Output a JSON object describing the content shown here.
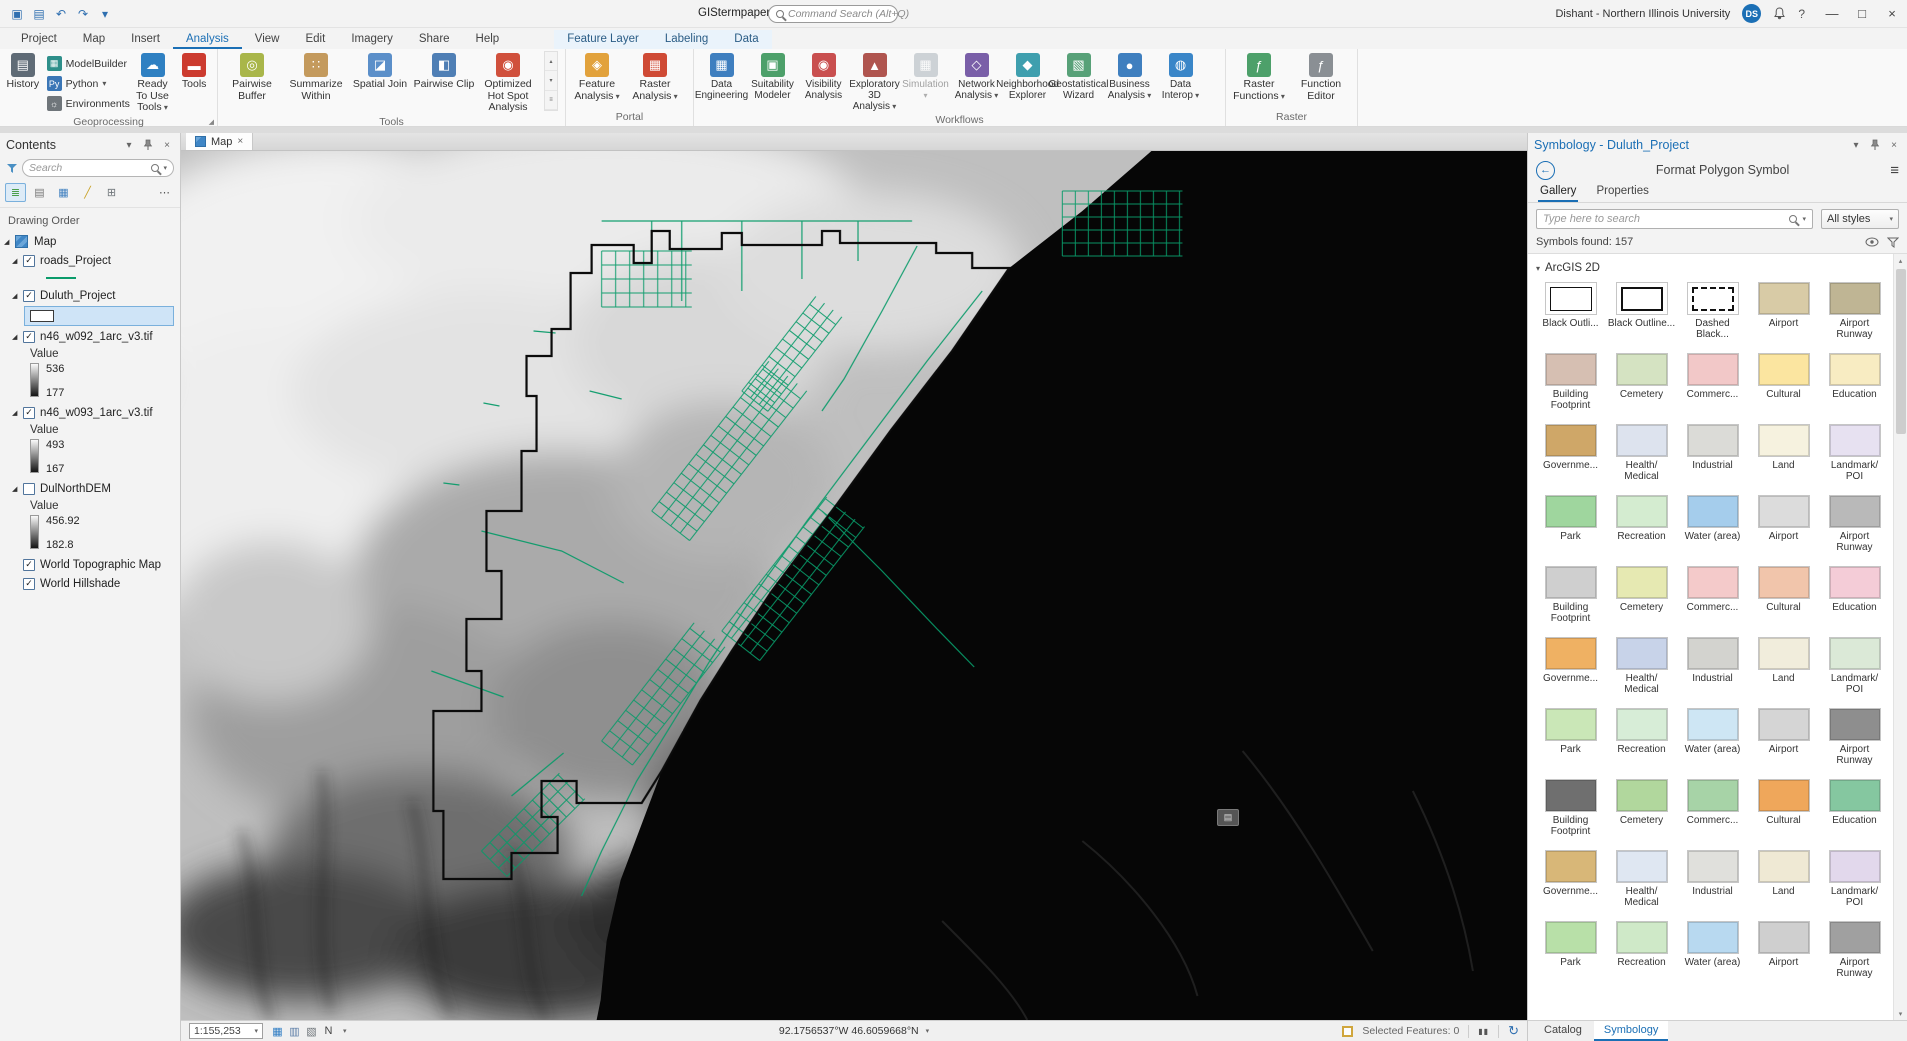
{
  "colors": {
    "accent": "#1b6fb5",
    "road_green": "#0a9b6a",
    "boundary_black": "#0b0b0b",
    "lake_black": "#060606",
    "selection_blue": "#cfe4f7"
  },
  "icons": {
    "chevron-down": "▾",
    "chevron-up": "▴",
    "close": "×",
    "more": "⋯",
    "menu": "≡",
    "back-arrow": "←",
    "expander": "◢",
    "check": "✓",
    "launcher": "◢",
    "pause": "▮▮",
    "refresh": "↻",
    "help": "?",
    "minimize": "—",
    "maximize": "□"
  },
  "titlebar": {
    "project_name": "GIStermpaper",
    "search_placeholder": "Command Search (Alt+Q)",
    "user_name": "Dishant - Northern Illinois University",
    "avatar_initials": "DS",
    "qat": [
      {
        "name": "save-button",
        "glyph": "▣"
      },
      {
        "name": "open-project-button",
        "glyph": "▤"
      },
      {
        "name": "undo-button",
        "glyph": "↶"
      },
      {
        "name": "redo-button",
        "glyph": "↷"
      },
      {
        "name": "customize-quick-access-button",
        "glyph": "▾"
      }
    ],
    "window_controls": [
      {
        "name": "minimize-button",
        "glyph": "—"
      },
      {
        "name": "maximize-button",
        "glyph": "□"
      },
      {
        "name": "close-button",
        "glyph": "×"
      }
    ]
  },
  "ribbon": {
    "tabs": [
      "Project",
      "Map",
      "Insert",
      "Analysis",
      "View",
      "Edit",
      "Imagery",
      "Share",
      "Help"
    ],
    "active_tab": "Analysis",
    "contextual_tabs": [
      "Feature Layer",
      "Labeling",
      "Data"
    ],
    "groups": [
      {
        "name": "Geoprocessing",
        "launcher": true,
        "items": [
          {
            "type": "large",
            "label": "History",
            "icon": "history-icon",
            "glyph": "▤",
            "color": "#5f6b76"
          },
          {
            "type": "smallcol",
            "buttons": [
              {
                "label": "ModelBuilder",
                "icon": "modelbuilder-icon",
                "glyph": "▦",
                "color": "#2e8f8a"
              },
              {
                "label": "Python",
                "icon": "python-icon",
                "glyph": "Py",
                "color": "#3a76b6",
                "dropdown": true
              },
              {
                "label": "Environments",
                "icon": "environments-icon",
                "glyph": "☼",
                "color": "#6f757a"
              }
            ]
          },
          {
            "type": "large",
            "label": "Ready To Use Tools",
            "icon": "ready-to-use-tools-icon",
            "glyph": "☁",
            "color": "#2f80c2",
            "dropdown": true
          },
          {
            "type": "large",
            "label": "Tools",
            "icon": "toolbox-icon",
            "glyph": "▬",
            "color": "#cc3b2f"
          }
        ]
      },
      {
        "name": "Tools",
        "items": [
          {
            "type": "large",
            "label": "Pairwise Buffer",
            "icon": "pairwise-buffer-icon",
            "glyph": "◎",
            "color": "#a9b64a"
          },
          {
            "type": "large",
            "label": "Summarize Within",
            "icon": "summarize-within-icon",
            "glyph": "∷",
            "color": "#c49a5d"
          },
          {
            "type": "large",
            "label": "Spatial Join",
            "icon": "spatial-join-icon",
            "glyph": "◪",
            "color": "#5b8fc9"
          },
          {
            "type": "large",
            "label": "Pairwise Clip",
            "icon": "pairwise-clip-icon",
            "glyph": "◧",
            "color": "#4f7fb5"
          },
          {
            "type": "large",
            "label": "Optimized Hot Spot Analysis",
            "icon": "hot-spot-analysis-icon",
            "glyph": "◉",
            "color": "#d0503c"
          },
          {
            "type": "scroller"
          }
        ]
      },
      {
        "name": "Portal",
        "items": [
          {
            "type": "large",
            "label": "Feature Analysis",
            "icon": "feature-analysis-icon",
            "glyph": "◈",
            "color": "#e2a23c",
            "dropdown": true
          },
          {
            "type": "large",
            "label": "Raster Analysis",
            "icon": "raster-analysis-icon",
            "glyph": "▦",
            "color": "#cf4a35",
            "dropdown": true
          }
        ]
      },
      {
        "name": "Workflows",
        "items": [
          {
            "type": "large",
            "label": "Data Engineering",
            "icon": "data-engineering-icon",
            "glyph": "▦",
            "color": "#3f7fbf"
          },
          {
            "type": "large",
            "label": "Suitability Modeler",
            "icon": "suitability-modeler-icon",
            "glyph": "▣",
            "color": "#4da06a"
          },
          {
            "type": "large",
            "label": "Visibility Analysis",
            "icon": "visibility-analysis-icon",
            "glyph": "◉",
            "color": "#c94f4f"
          },
          {
            "type": "large",
            "label": "Exploratory 3D Analysis",
            "icon": "exploratory-3d-analysis-icon",
            "glyph": "▲",
            "color": "#b0554f",
            "dropdown": true
          },
          {
            "type": "large",
            "label": "Simulation",
            "icon": "simulation-icon",
            "glyph": "▦",
            "color": "#9aa4ad",
            "dropdown": true,
            "disabled": true
          },
          {
            "type": "large",
            "label": "Network Analysis",
            "icon": "network-analysis-icon",
            "glyph": "◇",
            "color": "#7a5fa8",
            "dropdown": true
          },
          {
            "type": "large",
            "label": "Neighborhood Explorer",
            "icon": "neighborhood-explorer-icon",
            "glyph": "◆",
            "color": "#3f9fae"
          },
          {
            "type": "large",
            "label": "Geostatistical Wizard",
            "icon": "geostatistical-wizard-icon",
            "glyph": "▧",
            "color": "#58a178"
          },
          {
            "type": "large",
            "label": "Business Analysis",
            "icon": "business-analysis-icon",
            "glyph": "●",
            "color": "#3f7fbf",
            "dropdown": true
          },
          {
            "type": "large",
            "label": "Data Interop",
            "icon": "data-interop-icon",
            "glyph": "◍",
            "color": "#3a86c8",
            "dropdown": true
          }
        ]
      },
      {
        "name": "Raster",
        "items": [
          {
            "type": "large",
            "label": "Raster Functions",
            "icon": "raster-functions-icon",
            "glyph": "ƒ",
            "color": "#4da06a",
            "dropdown": true
          },
          {
            "type": "large",
            "label": "Function Editor",
            "icon": "function-editor-icon",
            "glyph": "ƒ",
            "color": "#8a8f94"
          }
        ]
      }
    ]
  },
  "contents": {
    "title": "Contents",
    "search_placeholder": "Search",
    "section_label": "Drawing Order",
    "toolbar": [
      {
        "name": "drawing-order-icon",
        "glyph": "≣",
        "color": "#4a9e4a",
        "selected": true
      },
      {
        "name": "data-source-icon",
        "glyph": "▤",
        "color": "#777777"
      },
      {
        "name": "selection-icon",
        "glyph": "▦",
        "color": "#3f7fbf"
      },
      {
        "name": "editing-icon",
        "glyph": "╱",
        "color": "#c9a227"
      },
      {
        "name": "snapping-icon",
        "glyph": "⊞",
        "color": "#6f757a"
      },
      {
        "name": "more-options-icon",
        "glyph": "⋯",
        "color": "#555555",
        "more": true
      }
    ],
    "layers": [
      {
        "label": "Map",
        "expander": true,
        "icon": "map-icon",
        "level": 0
      },
      {
        "label": "roads_Project",
        "expander": true,
        "checkbox": true,
        "checked": true,
        "symbol": "line"
      },
      {
        "label": "Duluth_Project",
        "expander": true,
        "checkbox": true,
        "checked": true,
        "symbol": "polygon-outline",
        "symbol_selected": true
      },
      {
        "label": "n46_w092_1arc_v3.tif",
        "expander": true,
        "checkbox": true,
        "checked": true,
        "legend": {
          "title": "Value",
          "max": "536",
          "min": "177"
        }
      },
      {
        "label": "n46_w093_1arc_v3.tif",
        "expander": true,
        "checkbox": true,
        "checked": true,
        "legend": {
          "title": "Value",
          "max": "493",
          "min": "167"
        }
      },
      {
        "label": "DulNorthDEM",
        "expander": true,
        "checkbox": true,
        "checked": false,
        "legend": {
          "title": "Value",
          "max": "456.92",
          "min": "182.8"
        }
      },
      {
        "label": "World Topographic Map",
        "checkbox": true,
        "checked": true
      },
      {
        "label": "World Hillshade",
        "checkbox": true,
        "checked": true
      }
    ]
  },
  "map": {
    "tab_label": "Map",
    "statusbar": {
      "scale": "1:155,253",
      "coordinates": "92.1756537°W 46.6059668°N",
      "selected_features_label": "Selected Features: 0",
      "icons": [
        {
          "name": "map-grid-icon",
          "glyph": "▦",
          "color": "#2e7cc3"
        },
        {
          "name": "table-view-icon",
          "glyph": "▥",
          "color": "#5a7ca6"
        },
        {
          "name": "snap-toggle-icon",
          "glyph": "▧",
          "color": "#6f757a"
        },
        {
          "name": "north-arrow-icon",
          "glyph": "N",
          "color": "#444444"
        }
      ]
    }
  },
  "symbology": {
    "title": "Symbology - Duluth_Project",
    "subtitle": "Format Polygon Symbol",
    "tabs": [
      "Gallery",
      "Properties"
    ],
    "active_tab": "Gallery",
    "search_placeholder": "Type here to search",
    "styles_dropdown": "All styles",
    "results_text": "Symbols found: 157",
    "section": "ArcGIS 2D",
    "bottom_tabs": [
      "Catalog",
      "Symbology"
    ],
    "active_bottom_tab": "Symbology",
    "symbols": [
      {
        "label": "Black Outli...",
        "fill": "#ffffff",
        "outline": "thin"
      },
      {
        "label": "Black Outline...",
        "fill": "#ffffff",
        "outline": "thick"
      },
      {
        "label": "Dashed Black...",
        "fill": "#ffffff",
        "outline": "dashed"
      },
      {
        "label": "Airport",
        "fill": "#d8cba6"
      },
      {
        "label": "Airport Runway",
        "fill": "#bfb594"
      },
      {
        "label": "Building Footprint",
        "fill": "#d6bfb2"
      },
      {
        "label": "Cemetery",
        "fill": "#d5e3c2"
      },
      {
        "label": "Commerc...",
        "fill": "#f2c8c8"
      },
      {
        "label": "Cultural",
        "fill": "#fbe5a0"
      },
      {
        "label": "Education",
        "fill": "#f8ecc2"
      },
      {
        "label": "Governme...",
        "fill": "#cfa768"
      },
      {
        "label": "Health/\nMedical",
        "fill": "#dde3ee"
      },
      {
        "label": "Industrial",
        "fill": "#dbdbd7"
      },
      {
        "label": "Land",
        "fill": "#f6f2df"
      },
      {
        "label": "Landmark/\nPOI",
        "fill": "#e7e1f1"
      },
      {
        "label": "Park",
        "fill": "#9fd69e"
      },
      {
        "label": "Recreation",
        "fill": "#d4ecd0"
      },
      {
        "label": "Water (area)",
        "fill": "#a5cdec"
      },
      {
        "label": "Airport",
        "fill": "#dcdcdc"
      },
      {
        "label": "Airport Runway",
        "fill": "#b9b9b9"
      },
      {
        "label": "Building Footprint",
        "fill": "#cfcfcf"
      },
      {
        "label": "Cemetery",
        "fill": "#e6e9b2"
      },
      {
        "label": "Commerc...",
        "fill": "#f4caca"
      },
      {
        "label": "Cultural",
        "fill": "#f1c5ab"
      },
      {
        "label": "Education",
        "fill": "#f4ccd7"
      },
      {
        "label": "Governme...",
        "fill": "#efb163"
      },
      {
        "label": "Health/\nMedical",
        "fill": "#c8d3e9"
      },
      {
        "label": "Industrial",
        "fill": "#d3d3cf"
      },
      {
        "label": "Land",
        "fill": "#f1eddc"
      },
      {
        "label": "Landmark/\nPOI",
        "fill": "#dbe9d7"
      },
      {
        "label": "Park",
        "fill": "#cae7b7"
      },
      {
        "label": "Recreation",
        "fill": "#d7edd7"
      },
      {
        "label": "Water (area)",
        "fill": "#cee6f4"
      },
      {
        "label": "Airport",
        "fill": "#d5d5d5"
      },
      {
        "label": "Airport Runway",
        "fill": "#8e8e8e"
      },
      {
        "label": "Building Footprint",
        "fill": "#6f6f6f"
      },
      {
        "label": "Cemetery",
        "fill": "#b1d79d"
      },
      {
        "label": "Commerc...",
        "fill": "#a7d3a7"
      },
      {
        "label": "Cultural",
        "fill": "#efa75b"
      },
      {
        "label": "Education",
        "fill": "#85c7a0"
      },
      {
        "label": "Governme...",
        "fill": "#d8b778"
      },
      {
        "label": "Health/\nMedical",
        "fill": "#dfe7f2"
      },
      {
        "label": "Industrial",
        "fill": "#e0e0dc"
      },
      {
        "label": "Land",
        "fill": "#efe9d4"
      },
      {
        "label": "Landmark/\nPOI",
        "fill": "#e2d8ec"
      },
      {
        "label": "Park",
        "fill": "#b8e0a8"
      },
      {
        "label": "Recreation",
        "fill": "#cfe9c8"
      },
      {
        "label": "Water (area)",
        "fill": "#b8d9f0"
      },
      {
        "label": "Airport",
        "fill": "#cfcfcf"
      },
      {
        "label": "Airport Runway",
        "fill": "#a0a0a0"
      }
    ]
  }
}
